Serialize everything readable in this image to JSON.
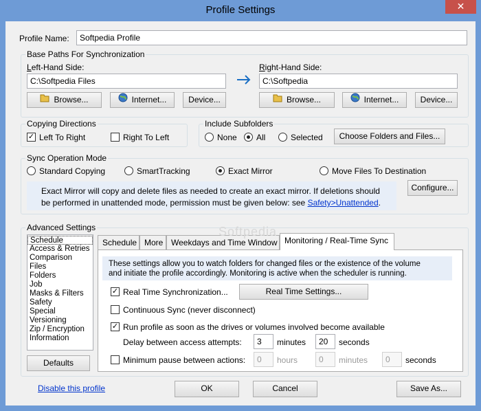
{
  "window": {
    "title": "Profile Settings",
    "close": "✕"
  },
  "profile_name": {
    "label": "Profile Name:",
    "value": "Softpedia Profile"
  },
  "base_paths": {
    "label": "Base Paths For Synchronization",
    "left": {
      "label": "Left-Hand Side:",
      "value": "C:\\Softpedia Files",
      "browse": "Browse...",
      "internet": "Internet...",
      "device": "Device..."
    },
    "right": {
      "label": "Right-Hand Side:",
      "value": "C:\\Softpedia",
      "browse": "Browse...",
      "internet": "Internet...",
      "device": "Device..."
    },
    "arrow": "→"
  },
  "copying_directions": {
    "label": "Copying Directions",
    "left_to_right": {
      "label": "Left To Right",
      "checked": true
    },
    "right_to_left": {
      "label": "Right To Left",
      "checked": false
    }
  },
  "include_subfolders": {
    "label": "Include Subfolders",
    "options": [
      "None",
      "All",
      "Selected"
    ],
    "selected": "All",
    "choose_button": "Choose Folders and Files..."
  },
  "sync_mode": {
    "label": "Sync Operation Mode",
    "options": [
      "Standard Copying",
      "SmartTracking",
      "Exact Mirror",
      "Move Files To Destination"
    ],
    "selected": "Exact Mirror",
    "description_line1": "Exact Mirror will copy and delete files as needed to create an exact mirror. If deletions should",
    "description_line2": "be performed in unattended mode, permission must be given below: see",
    "link": "Safety>Unattended",
    "after_link": ".",
    "configure": "Configure..."
  },
  "advanced": {
    "label": "Advanced Settings",
    "categories": [
      "Schedule",
      "Access & Retries",
      "Comparison",
      "Files",
      "Folders",
      "Job",
      "Masks & Filters",
      "Safety",
      "Special",
      "Versioning",
      "Zip / Encryption",
      "Information"
    ],
    "selected_category": "Schedule",
    "defaults_button": "Defaults",
    "tabs": [
      "Schedule",
      "More",
      "Weekdays and Time Window",
      "Monitoring / Real-Time Sync"
    ],
    "active_tab": "Monitoring / Real-Time Sync",
    "info_line1": "These settings allow you to watch folders for changed files or the existence of the volume",
    "info_line2": "and initiate the profile accordingly. Monitoring is active when the scheduler is running.",
    "realtime": {
      "label": "Real Time Synchronization...",
      "checked": true,
      "button": "Real Time Settings..."
    },
    "continuous": {
      "label": "Continuous Sync (never disconnect)",
      "checked": false
    },
    "run_profile": {
      "label": "Run profile as soon as the drives or volumes involved become available",
      "checked": true
    },
    "delay": {
      "label": "Delay between access attempts:",
      "minutes_value": "3",
      "minutes_unit": "minutes",
      "seconds_value": "20",
      "seconds_unit": "seconds"
    },
    "min_pause": {
      "label": "Minimum pause between actions:",
      "checked": false,
      "hours_value": "0",
      "hours_unit": "hours",
      "minutes_value": "0",
      "minutes_unit": "minutes",
      "seconds_value": "0",
      "seconds_unit": "seconds"
    }
  },
  "footer": {
    "disable_link": "Disable this profile",
    "ok": "OK",
    "cancel": "Cancel",
    "save_as": "Save As..."
  },
  "watermark": "Softpedia",
  "colors": {
    "title_bar": "#6e9bd6",
    "close_button": "#c7514a",
    "info_background": "#e7eef8",
    "link": "#0033cc",
    "arrow": "#1a6fc4"
  }
}
